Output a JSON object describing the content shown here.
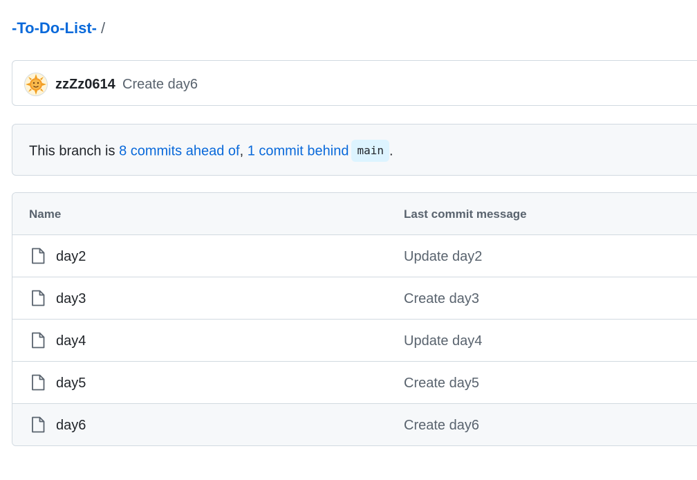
{
  "breadcrumb": {
    "repo": "-To-Do-List-",
    "separator": "/"
  },
  "latest_commit": {
    "author": "zzZz0614",
    "message": "Create day6",
    "avatar_icon": "sun-face-avatar"
  },
  "branch_status": {
    "prefix": "This branch is ",
    "ahead": "8 commits ahead of",
    "comma": ", ",
    "behind": "1 commit behind",
    "base_branch": "main",
    "suffix": "."
  },
  "file_table": {
    "headers": {
      "name": "Name",
      "last_commit_message": "Last commit message"
    },
    "rows": [
      {
        "name": "day2",
        "message": "Update day2",
        "icon": "file-icon"
      },
      {
        "name": "day3",
        "message": "Create day3",
        "icon": "file-icon"
      },
      {
        "name": "day4",
        "message": "Update day4",
        "icon": "file-icon"
      },
      {
        "name": "day5",
        "message": "Create day5",
        "icon": "file-icon"
      },
      {
        "name": "day6",
        "message": "Create day6",
        "icon": "file-icon"
      }
    ]
  },
  "colors": {
    "link": "#0969da",
    "muted": "#59636e",
    "border": "#d1d9e0",
    "subtle_bg": "#f6f8fa",
    "branch_pill_bg": "#ddf4ff"
  }
}
